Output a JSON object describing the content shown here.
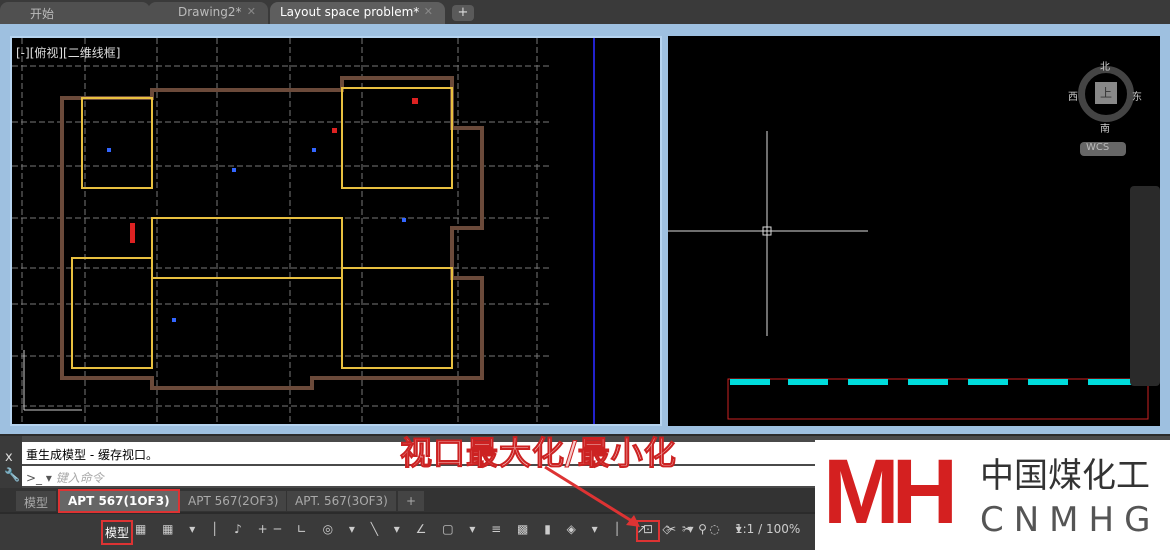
{
  "file_tabs": [
    {
      "label": "开始"
    },
    {
      "label": "Drawing2*"
    },
    {
      "label": "Layout space problem*"
    }
  ],
  "new_tab": "+",
  "viewport": {
    "label": "[-][俯视][二维线框]"
  },
  "viewcube": {
    "north": "北",
    "south": "南",
    "east": "东",
    "west": "西",
    "face": "上",
    "ucs": "WCS"
  },
  "command": {
    "history": "重生成模型 - 缓存视口。",
    "placeholder": "键入命令",
    "close": "x"
  },
  "layout_tabs": [
    {
      "label": "模型"
    },
    {
      "label": "APT 567(1OF3)"
    },
    {
      "label": "APT 567(2OF3)"
    },
    {
      "label": "APT. 567(3OF3)"
    },
    {
      "label": "+"
    }
  ],
  "status": {
    "model": "模型",
    "scale": "1:1 / 100%"
  },
  "annotation": "视口最大化/最小化",
  "logo": {
    "letters": "MH",
    "cn": "中国煤化工",
    "en": "CNMHG"
  }
}
